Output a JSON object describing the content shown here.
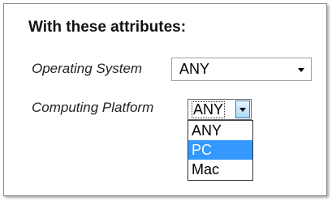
{
  "panel": {
    "title": "With these attributes:"
  },
  "fields": {
    "operating_system": {
      "label": "Operating System",
      "value": "ANY",
      "icon": "chevron-down-icon"
    },
    "computing_platform": {
      "label": "Computing Platform",
      "value": "ANY",
      "icon": "chevron-down-icon",
      "options": [
        "ANY",
        "PC",
        "Mac"
      ],
      "highlighted_option": "PC"
    }
  },
  "colors": {
    "highlight": "#3399ff",
    "highlight_text": "#ffffff",
    "dropdown_button_border": "#3c7fb1"
  }
}
